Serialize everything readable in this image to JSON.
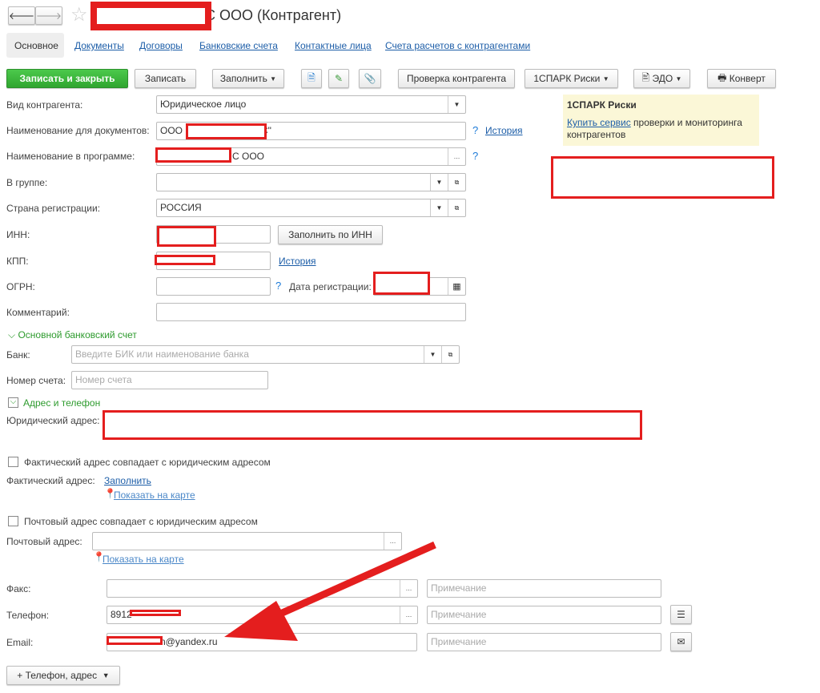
{
  "title": "С ООО (Контрагент)",
  "tabs": [
    "Основное",
    "Документы",
    "Договоры",
    "Банковские счета",
    "Контактные лица",
    "Счета расчетов с контрагентами"
  ],
  "toolbar": {
    "save_close": "Записать и закрыть",
    "save": "Записать",
    "fill": "Заполнить",
    "check": "Проверка контрагента",
    "spark": "1СПАРК Риски",
    "edo": "ЭДО",
    "envelope": "Конверт"
  },
  "spark_panel": {
    "title": "1СПАРК Риски",
    "link": "Купить сервис",
    "text": " проверки и мониторинга контрагентов"
  },
  "form": {
    "kind_label": "Вид контрагента:",
    "kind_value": "Юридическое лицо",
    "docname_label": "Наименование для документов:",
    "docname_value": "ООО",
    "docname_tail": "С\"",
    "progname_label": "Наименование в программе:",
    "progname_value": "С ООО",
    "group_label": "В группе:",
    "country_label": "Страна регистрации:",
    "country_value": "РОССИЯ",
    "inn_label": "ИНН:",
    "inn_fill": "Заполнить по ИНН",
    "kpp_label": "КПП:",
    "history": "История",
    "ogrn_label": "ОГРН:",
    "regdate_label": "Дата регистрации:",
    "comment_label": "Комментарий:",
    "q": "?"
  },
  "bank": {
    "section": "Основной банковский счет",
    "bank_label": "Банк:",
    "bank_placeholder": "Введите БИК или наименование банка",
    "account_label": "Номер счета:",
    "account_placeholder": "Номер счета"
  },
  "address": {
    "section": "Адрес и телефон",
    "legal_label": "Юридический адрес:",
    "actual_same": "Фактический адрес совпадает с юридическим адресом",
    "actual_label": "Фактический адрес:",
    "fill_link": "Заполнить",
    "map_link": "Показать на карте",
    "postal_same": "Почтовый адрес совпадает с юридическим адресом",
    "postal_label": "Почтовый адрес:"
  },
  "contacts": {
    "fax_label": "Факс:",
    "phone_label": "Телефон:",
    "phone_value": "8912",
    "email_label": "Email:",
    "email_value": "n@yandex.ru",
    "note_placeholder": "Примечание",
    "add_button": "+ Телефон, адрес"
  }
}
